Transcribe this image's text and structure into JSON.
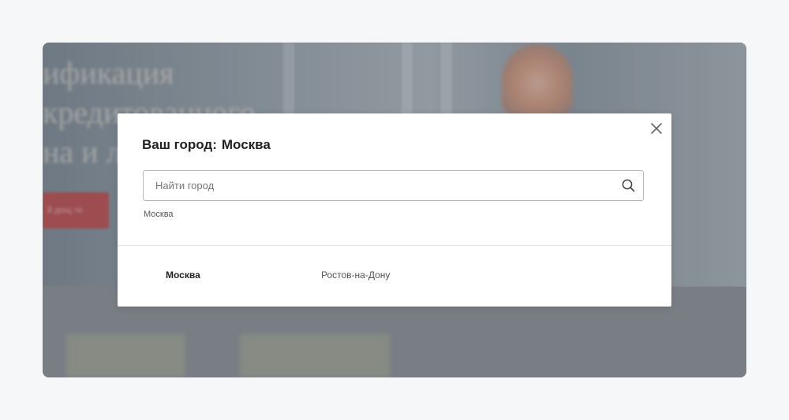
{
  "background": {
    "headline": "ификация\nкредитованного\nна и л",
    "button_label": "й дощ те"
  },
  "modal": {
    "title_prefix": "Ваш город:",
    "current_city": "Москва",
    "search": {
      "placeholder": "Найти город",
      "value": ""
    },
    "suggestion": "Москва",
    "cities": [
      {
        "label": "Москва",
        "active": true
      },
      {
        "label": "Ростов-на-Дону",
        "active": false
      }
    ],
    "icons": {
      "close": "close-icon",
      "search": "search-icon"
    }
  },
  "colors": {
    "page_bg": "#f6f7f9",
    "modal_bg": "#ffffff",
    "title_text": "#222222",
    "muted_text": "#555555",
    "input_border": "#b9b9b9",
    "bg_button": "#b85457"
  }
}
